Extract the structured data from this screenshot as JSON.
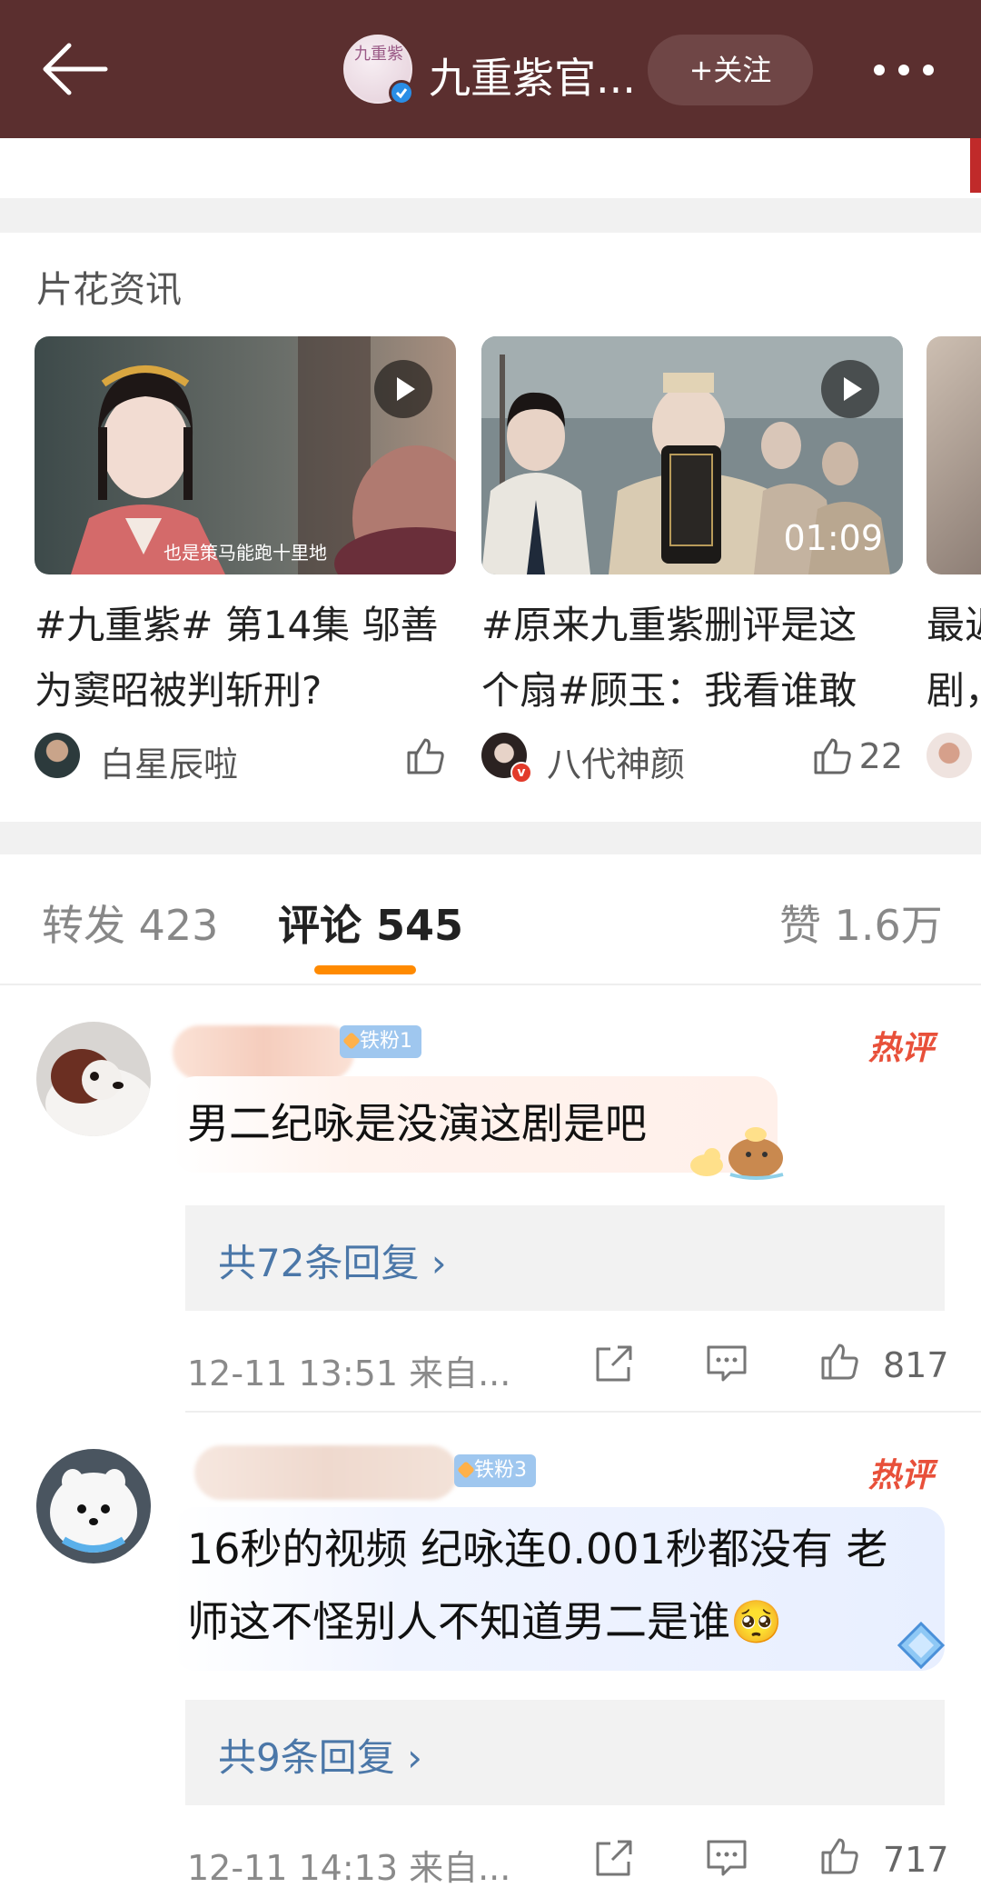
{
  "header": {
    "avatar_glyph": "九重紫",
    "title": "九重紫官...",
    "follow_label": "+关注"
  },
  "clips": {
    "section_title": "片花资讯",
    "cards": [
      {
        "subtitle": "也是策马能跑十里地",
        "duration": "",
        "title_line1": "#九重紫# 第14集 邬善",
        "title_line2": "为窦昭被判斩刑?",
        "author": "白星辰啦",
        "likes": ""
      },
      {
        "subtitle": "",
        "duration": "01:09",
        "title_line1": "#原来九重紫删评是这",
        "title_line2": "个扇#顾玉：我看谁敢",
        "author": "八代神颜",
        "likes": "22"
      },
      {
        "title_line1": "最近",
        "title_line2": "剧，"
      }
    ]
  },
  "tabs": {
    "repost": "转发 423",
    "comments": "评论 545",
    "likes": "赞 1.6万"
  },
  "comments": [
    {
      "fan_badge": "铁粉1",
      "hot_label": "热评",
      "text": "男二纪咏是没演这剧是吧",
      "reply_label": "共72条回复 ›",
      "time_source": "12-11 13:51  来自...",
      "likes": "817"
    },
    {
      "fan_badge": "铁粉3",
      "hot_label": "热评",
      "text_line1": "16秒的视频 纪咏连0.001秒都没有 老",
      "text_line2": "师这不怪别人不知道男二是谁🥺",
      "reply_label": "共9条回复 ›",
      "time_source": "12-11 14:13  来自...",
      "likes": "717"
    }
  ],
  "colors": {
    "header_bg": "#5b2f2f",
    "accent_orange": "#ff8a00",
    "reply_link": "#4b77a8",
    "hot_red": "#e8503a",
    "fan_badge": "#9fc7ef"
  }
}
